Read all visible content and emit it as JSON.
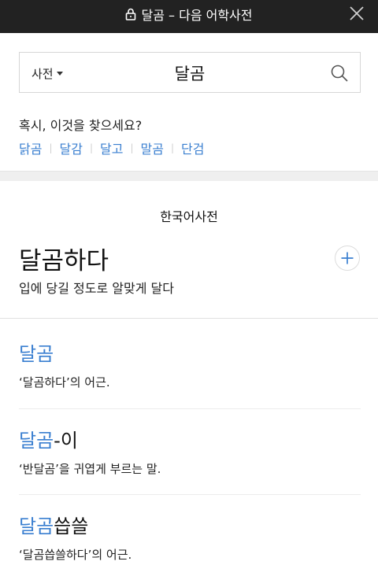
{
  "browser": {
    "title": "달곰 – 다음 어학사전"
  },
  "search": {
    "dict_label": "사전",
    "query": "달곰"
  },
  "suggestions": {
    "heading": "혹시, 이것을 찾으세요?",
    "items": [
      "닭곰",
      "달감",
      "달고",
      "말곰",
      "단검"
    ]
  },
  "section": {
    "label": "한국어사전"
  },
  "main_entry": {
    "headword": "달곰하다",
    "definition": "입에 당길 정도로 알맞게 달다"
  },
  "entries": [
    {
      "highlight": "달곰",
      "rest": "",
      "description": "‘달곰하다’의 어근."
    },
    {
      "highlight": "달곰",
      "rest": "-이",
      "description": "‘반달곰’을 귀엽게 부르는 말."
    },
    {
      "highlight": "달곰",
      "rest": "씁쓸",
      "description": "‘달곰씁쓸하다’의 어근."
    }
  ],
  "colors": {
    "topbar": "#222222",
    "link": "#3a7fd0",
    "highlight": "#ffe94f"
  },
  "icons": [
    "lock-icon",
    "close-icon",
    "caret-down-icon",
    "search-icon",
    "plus-icon"
  ]
}
